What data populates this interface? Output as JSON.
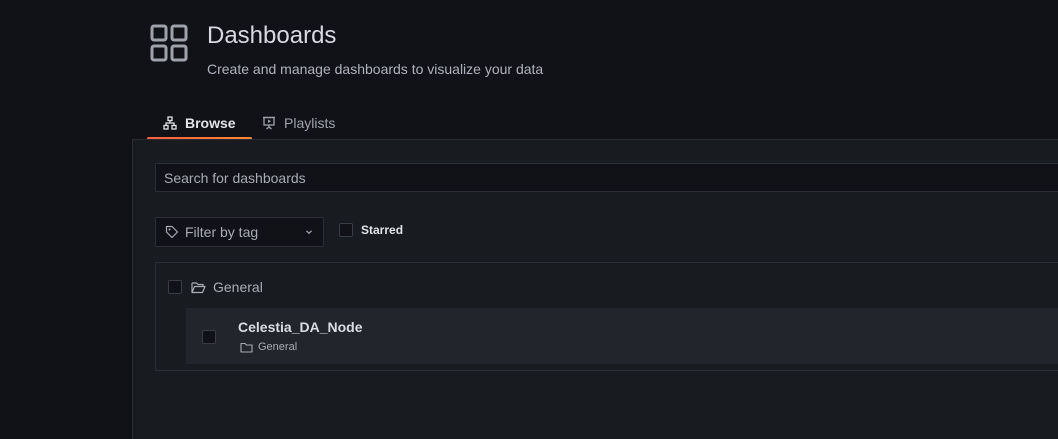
{
  "header": {
    "title": "Dashboards",
    "subtitle": "Create and manage dashboards to visualize your data",
    "icon": "apps-grid-icon"
  },
  "tabs": [
    {
      "label": "Browse",
      "icon": "sitemap-icon",
      "active": true
    },
    {
      "label": "Playlists",
      "icon": "presentation-play-icon",
      "active": false
    }
  ],
  "search": {
    "placeholder": "Search for dashboards",
    "value": ""
  },
  "filters": {
    "tag_filter_label": "Filter by tag",
    "starred_label": "Starred",
    "starred_checked": false
  },
  "folders": [
    {
      "name": "General",
      "checked": false,
      "dashboards": [
        {
          "title": "Celestia_DA_Node",
          "location": "General",
          "checked": false
        }
      ]
    }
  ],
  "colors": {
    "background": "#111217",
    "panel": "#181b1f",
    "active_tab_underline": "#f55f3e",
    "text": "#ccccdc"
  }
}
